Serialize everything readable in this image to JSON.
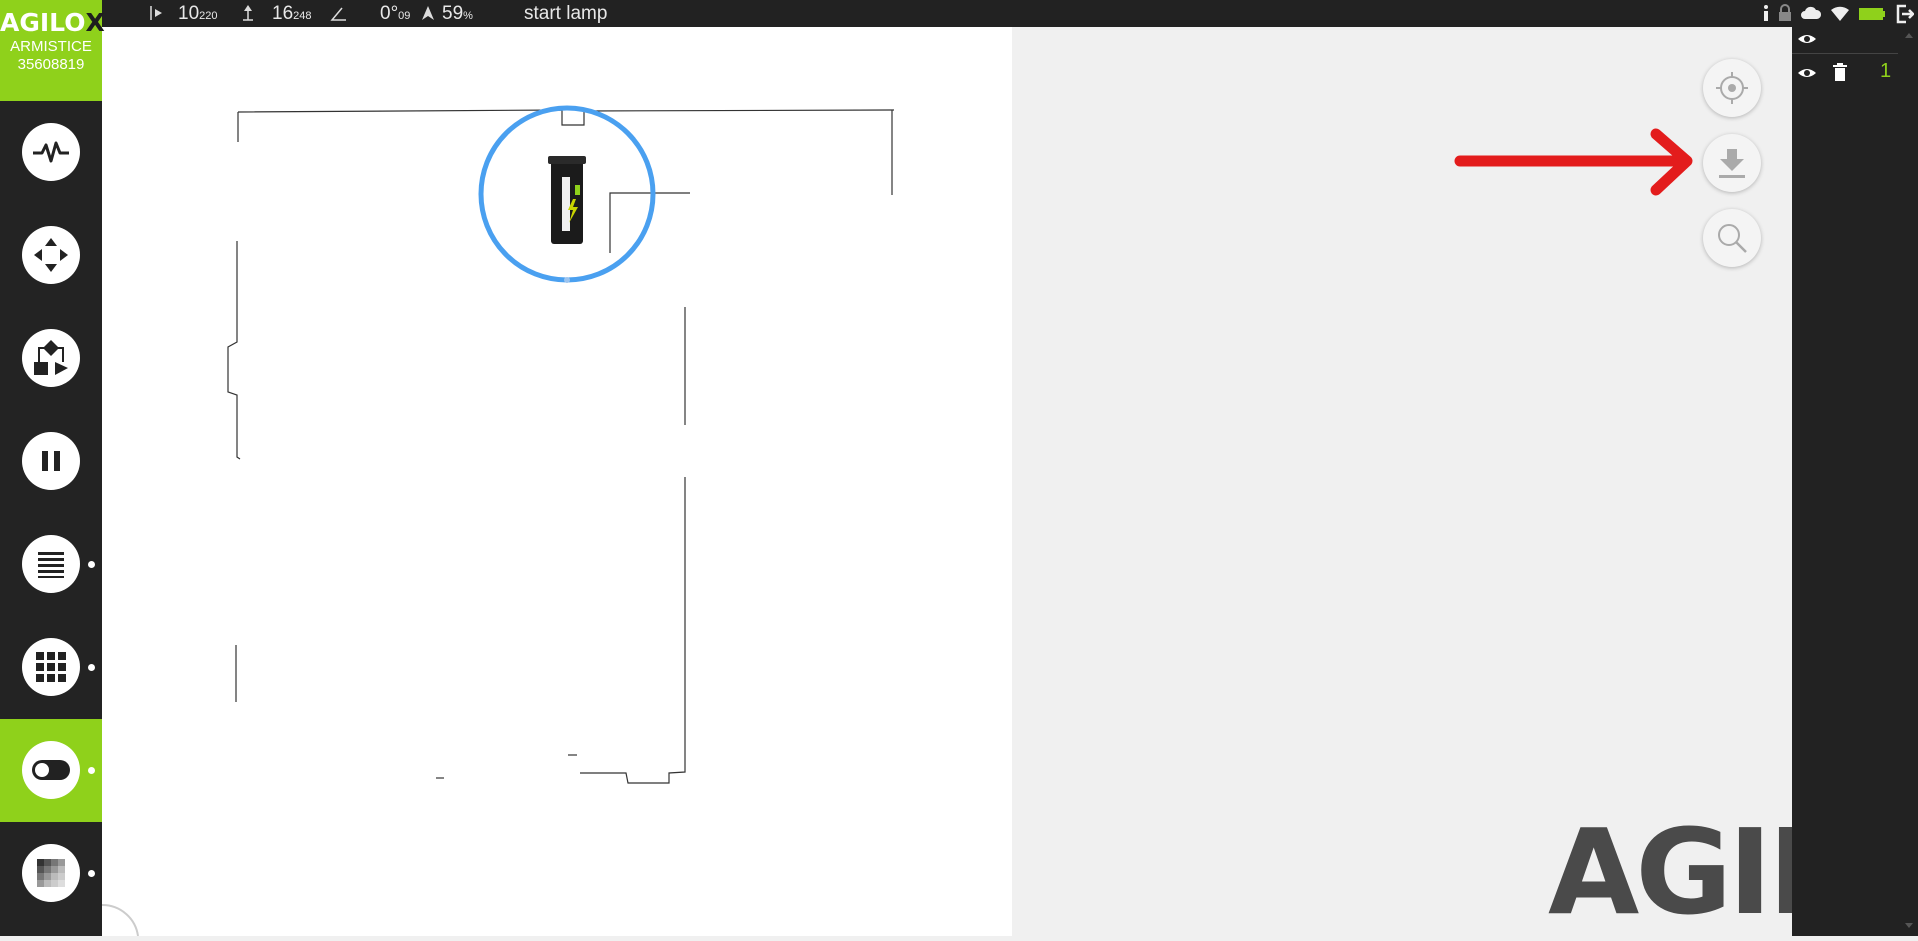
{
  "logo": {
    "brand_main": "AGILO",
    "brand_accent": "X",
    "robot_name": "ARMISTICE",
    "serial": "35608819"
  },
  "status": {
    "x_value": "10",
    "x_sub": "220",
    "y_value": "16",
    "y_sub": "248",
    "angle_value": "0°",
    "angle_sub": "09",
    "battery_value": "59",
    "battery_unit": "%",
    "message": "start lamp"
  },
  "sidebar": {
    "items": [
      {
        "icon": "pulse-icon",
        "active": false,
        "dot": false
      },
      {
        "icon": "move-arrows-icon",
        "active": false,
        "dot": false
      },
      {
        "icon": "workflow-icon",
        "active": false,
        "dot": false
      },
      {
        "icon": "pause-icon",
        "active": false,
        "dot": false
      },
      {
        "icon": "list-icon",
        "active": false,
        "dot": true
      },
      {
        "icon": "grid-icon",
        "active": false,
        "dot": true
      },
      {
        "icon": "toggle-icon",
        "active": true,
        "dot": true
      },
      {
        "icon": "layers-icon",
        "active": false,
        "dot": true
      }
    ]
  },
  "map_tools": [
    "locate-icon",
    "download-icon",
    "search-icon"
  ],
  "layers": {
    "count": "1"
  },
  "watermark": "AGILO",
  "colors": {
    "brand_green": "#8fd11b",
    "dark": "#222222",
    "robot_ring": "#4aa0f0",
    "annotation_arrow": "#e31c1c"
  }
}
